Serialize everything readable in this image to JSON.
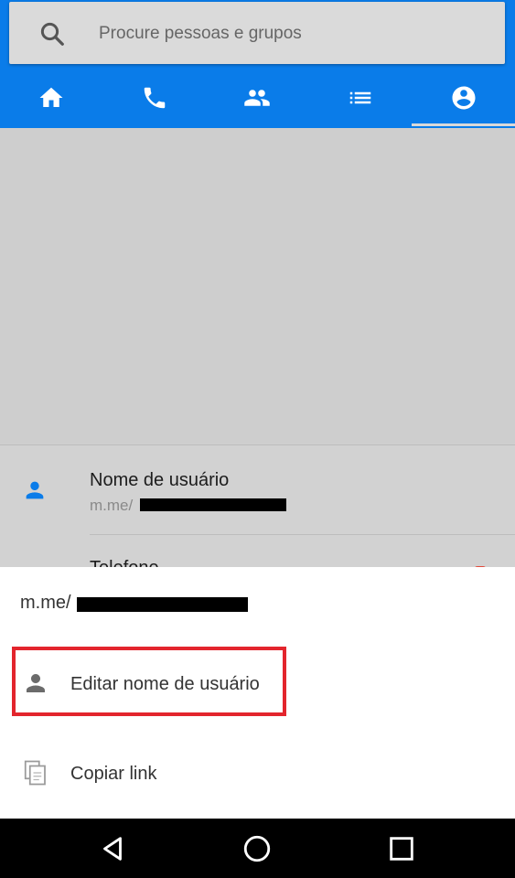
{
  "search": {
    "placeholder": "Procure pessoas e grupos",
    "icon": "search-icon"
  },
  "tabs": [
    {
      "icon": "home-icon",
      "active": false
    },
    {
      "icon": "phone-icon",
      "active": false
    },
    {
      "icon": "people-icon",
      "active": false
    },
    {
      "icon": "list-icon",
      "active": false
    },
    {
      "icon": "account-icon",
      "active": true
    }
  ],
  "profile": {
    "username_label": "Nome de usuário",
    "username_value_prefix": "m.me/",
    "phone_label": "Telefone"
  },
  "sheet": {
    "link_prefix": "m.me/",
    "options": [
      {
        "label": "Editar nome de usuário",
        "icon": "person-icon"
      },
      {
        "label": "Copiar link",
        "icon": "copy-icon"
      }
    ]
  },
  "colors": {
    "brand": "#0a7ce9",
    "highlight": "#e3252d"
  }
}
